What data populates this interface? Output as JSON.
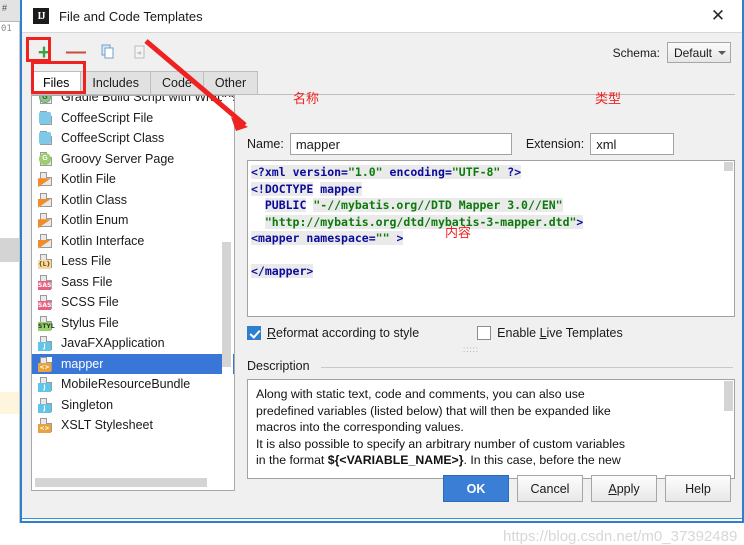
{
  "background": {
    "tab_label": "#",
    "line_number": "01"
  },
  "window": {
    "title": "File and Code Templates",
    "app_icon": "intellij-idea-icon",
    "close_icon": "close-icon"
  },
  "toolbar": {
    "add_label": "+",
    "remove_label": "—",
    "copy_icon": "copy-icon",
    "reset_icon": "reset-icon",
    "schema_label": "Schema:",
    "schema_value": "Default"
  },
  "tabs": [
    {
      "label": "Files",
      "active": true
    },
    {
      "label": "Includes",
      "active": false
    },
    {
      "label": "Code",
      "active": false
    },
    {
      "label": "Other",
      "active": false
    }
  ],
  "template_list": {
    "items": [
      {
        "label": "Gradle Build Script with Wrapper",
        "icon": "gradle-file-icon",
        "badge": "G",
        "badge_class": "badge-circle b-gradle",
        "selected": false
      },
      {
        "label": "CoffeeScript File",
        "icon": "coffeescript-file-icon",
        "badge": "",
        "badge_class": "badge-circle b-coffee",
        "selected": false
      },
      {
        "label": "CoffeeScript Class",
        "icon": "coffeescript-class-icon",
        "badge": "",
        "badge_class": "badge-circle b-coffee",
        "selected": false
      },
      {
        "label": "Groovy Server Page",
        "icon": "groovy-file-icon",
        "badge": "G",
        "badge_class": "badge-circle b-groovy",
        "selected": false
      },
      {
        "label": "Kotlin File",
        "icon": "kotlin-file-icon",
        "badge": "",
        "badge_class": "badge b-kotlin",
        "selected": false
      },
      {
        "label": "Kotlin Class",
        "icon": "kotlin-class-icon",
        "badge": "",
        "badge_class": "badge b-kotlin",
        "selected": false
      },
      {
        "label": "Kotlin Enum",
        "icon": "kotlin-enum-icon",
        "badge": "",
        "badge_class": "badge b-kotlin",
        "selected": false
      },
      {
        "label": "Kotlin Interface",
        "icon": "kotlin-interface-icon",
        "badge": "",
        "badge_class": "badge b-kotlin",
        "selected": false
      },
      {
        "label": "Less File",
        "icon": "less-file-icon",
        "badge": "{L}",
        "badge_class": "badge b-less",
        "selected": false
      },
      {
        "label": "Sass File",
        "icon": "sass-file-icon",
        "badge": "SASS",
        "badge_class": "badge b-sass",
        "selected": false
      },
      {
        "label": "SCSS File",
        "icon": "scss-file-icon",
        "badge": "SASS",
        "badge_class": "badge b-sass",
        "selected": false
      },
      {
        "label": "Stylus File",
        "icon": "stylus-file-icon",
        "badge": "STYL",
        "badge_class": "badge b-stylus",
        "selected": false
      },
      {
        "label": "JavaFXApplication",
        "icon": "java-file-icon",
        "badge": "J",
        "badge_class": "badge b-java",
        "selected": false
      },
      {
        "label": "mapper",
        "icon": "xml-file-icon",
        "badge": "<>",
        "badge_class": "badge b-xml",
        "selected": true
      },
      {
        "label": "MobileResourceBundle",
        "icon": "java-file-icon",
        "badge": "J",
        "badge_class": "badge b-java",
        "selected": false
      },
      {
        "label": "Singleton",
        "icon": "java-file-icon",
        "badge": "J",
        "badge_class": "badge b-java",
        "selected": false
      },
      {
        "label": "XSLT Stylesheet",
        "icon": "xml-file-icon",
        "badge": "<>",
        "badge_class": "badge b-xml",
        "selected": false
      }
    ]
  },
  "form": {
    "name_label": "Name:",
    "name_value": "mapper",
    "extension_label": "Extension:",
    "extension_value": "xml"
  },
  "editor": {
    "lines": [
      "<?xml version=\"1.0\" encoding=\"UTF-8\" ?>",
      "<!DOCTYPE mapper",
      "  PUBLIC \"-//mybatis.org//DTD Mapper 3.0//EN\"",
      "  \"http://mybatis.org/dtd/mybatis-3-mapper.dtd\">",
      "<mapper namespace=\"\" >",
      "",
      "</mapper>"
    ]
  },
  "options": {
    "reformat_label": "Reformat according to style",
    "reformat_checked": true,
    "live_templates_label": "Enable Live Templates",
    "live_templates_checked": false
  },
  "description": {
    "title": "Description",
    "text_line1": "Along with static text, code and comments, you can also use",
    "text_line2": "predefined variables (listed below) that will then be expanded like",
    "text_line3": "macros into the corresponding values.",
    "text_line4": "It is also possible to specify an arbitrary number of custom variables",
    "text_line5_pre": "in the format ",
    "text_line5_bold": "${<VARIABLE_NAME>}",
    "text_line5_post": ". In this case, before the new"
  },
  "buttons": [
    {
      "label": "OK",
      "primary": true
    },
    {
      "label": "Cancel",
      "primary": false
    },
    {
      "label": "Apply",
      "primary": false
    },
    {
      "label": "Help",
      "primary": false
    }
  ],
  "annotations": {
    "name_label": "名称",
    "type_label": "类型",
    "content_label": "内容",
    "color": "#ee2222"
  },
  "watermark": {
    "text": "https://blog.csdn.net/m0_37392489"
  }
}
